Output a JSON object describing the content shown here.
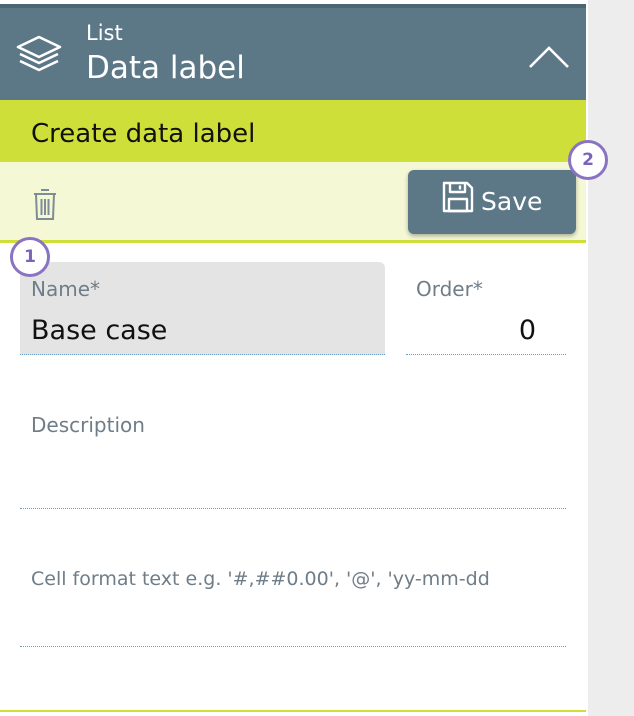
{
  "header": {
    "subtitle": "List",
    "title": "Data label"
  },
  "form": {
    "title": "Create data label",
    "save_label": "Save",
    "fields": {
      "name": {
        "label": "Name*",
        "value": "Base case"
      },
      "order": {
        "label": "Order*",
        "value": "0"
      },
      "description": {
        "label": "Description",
        "value": ""
      },
      "cell_format": {
        "placeholder": "Cell format text e.g. '#,##0.00', '@', 'yy-mm-dd"
      }
    }
  },
  "annotations": {
    "badge_1": "1",
    "badge_2": "2"
  },
  "icons": {
    "header": "layers-icon",
    "collapse": "chevron-up-icon",
    "delete": "trash-icon",
    "save": "floppy-disk-icon"
  },
  "colors": {
    "header_bg": "#5c7887",
    "accent_lime": "#cfdf3a",
    "toolbar_bg": "#f4f8d5",
    "badge_purple": "#8a73c2"
  }
}
